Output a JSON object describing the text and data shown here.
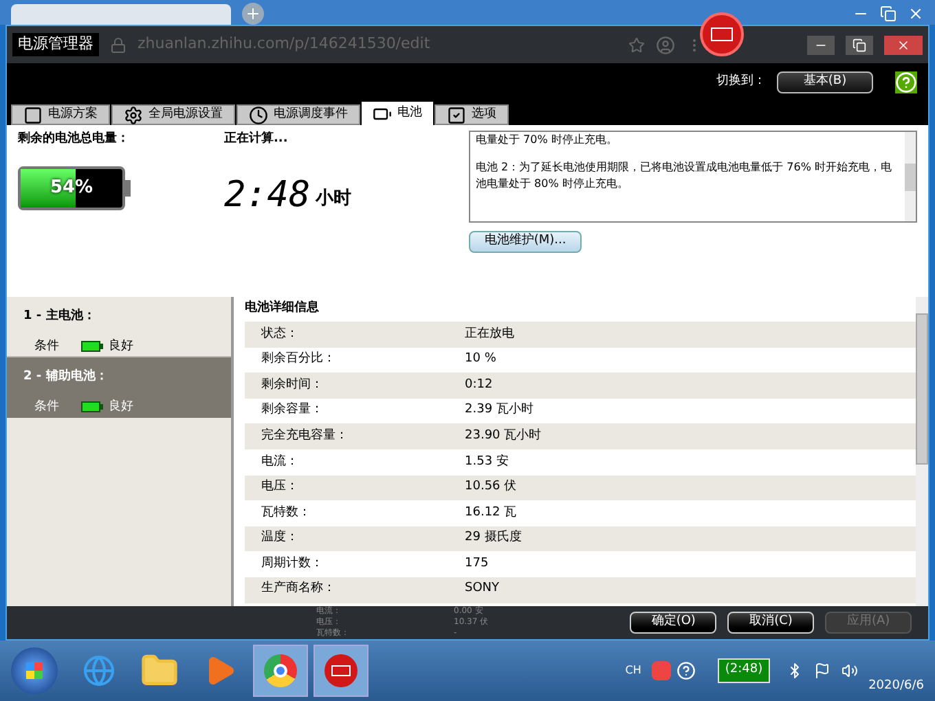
{
  "window": {
    "title": "电源管理器",
    "background_url": "zhuanlan.zhihu.com/p/146241530/edit"
  },
  "toolbar": {
    "switch_label": "切换到：",
    "switch_button": "基本(B)"
  },
  "tabs": [
    {
      "label": "电源方案",
      "kind": "plan",
      "selected": false
    },
    {
      "label": "全局电源设置",
      "kind": "gear",
      "selected": false
    },
    {
      "label": "电源调度事件",
      "kind": "clock",
      "selected": false
    },
    {
      "label": "电池",
      "kind": "battery",
      "selected": true
    },
    {
      "label": "选项",
      "kind": "check",
      "selected": false
    }
  ],
  "charge": {
    "label": "剩余的电池总电量：",
    "level": 0.54,
    "percent": "54%"
  },
  "time": {
    "label": "正在计算...",
    "value": "2:48",
    "unit": "小时"
  },
  "notes": [
    "电量处于 70% 时停止充电。",
    "电池 2：为了延长电池使用期限，已将电池设置成电池电量低于 76% 时开始充电，电池电量处于 80% 时停止充电。"
  ],
  "maintenance_button": "电池维护(M)...",
  "batteries": [
    {
      "title": "1 - 主电池：",
      "condition_label": "条件",
      "condition": "良好",
      "selected": false
    },
    {
      "title": "2 - 辅助电池：",
      "condition_label": "条件",
      "condition": "良好",
      "selected": true
    }
  ],
  "details": {
    "title": "电池详细信息",
    "rows": [
      {
        "label": "状态：",
        "value": "正在放电"
      },
      {
        "label": "剩余百分比：",
        "value": "10 %"
      },
      {
        "label": "剩余时间：",
        "value": "0:12"
      },
      {
        "label": "剩余容量：",
        "value": "2.39 瓦小时"
      },
      {
        "label": "完全充电容量：",
        "value": "23.90 瓦小时"
      },
      {
        "label": "电流：",
        "value": "1.53 安"
      },
      {
        "label": "电压：",
        "value": "10.56 伏"
      },
      {
        "label": "瓦特数：",
        "value": "16.12 瓦"
      },
      {
        "label": "温度：",
        "value": "29 摄氏度"
      },
      {
        "label": "周期计数：",
        "value": "175"
      },
      {
        "label": "生产商名称：",
        "value": "SONY"
      }
    ]
  },
  "behind_rows": [
    {
      "label": "电流：",
      "value": "0.00 安"
    },
    {
      "label": "电压：",
      "value": "10.37 伏"
    },
    {
      "label": "瓦特数：",
      "value": "-"
    }
  ],
  "buttons": [
    {
      "label": "确定(O)",
      "disabled": false
    },
    {
      "label": "取消(C)",
      "disabled": false
    },
    {
      "label": "应用(A)",
      "disabled": true
    }
  ],
  "taskbar": {
    "apps": [
      {
        "kind": "ie",
        "selected": false
      },
      {
        "kind": "folder",
        "selected": false
      },
      {
        "kind": "media",
        "selected": false
      },
      {
        "kind": "chrome",
        "selected": true
      },
      {
        "kind": "battery",
        "selected": true
      }
    ],
    "lang": "CH",
    "battery_time": "(2:48)",
    "date": "2020/6/6"
  }
}
